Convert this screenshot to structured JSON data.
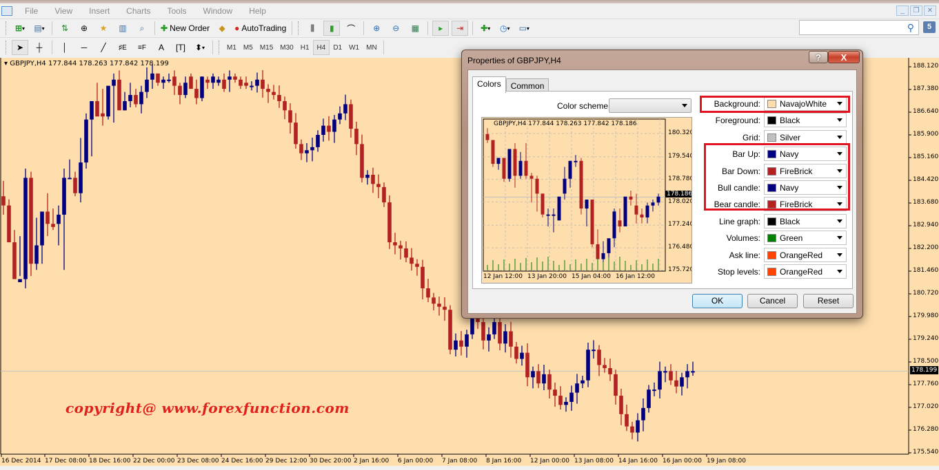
{
  "app": {
    "menu": [
      "File",
      "View",
      "Insert",
      "Charts",
      "Tools",
      "Window",
      "Help"
    ],
    "window_controls": [
      "minimize",
      "restore",
      "close"
    ]
  },
  "toolbar": {
    "new_order_label": "New Order",
    "autotrading_label": "AutoTrading",
    "timeframes": [
      "M1",
      "M5",
      "M15",
      "M30",
      "H1",
      "H4",
      "D1",
      "W1",
      "MN"
    ],
    "active_timeframe": "H4",
    "search_placeholder": "",
    "notification_count": "5"
  },
  "chart": {
    "symbol_header": "GBPJPY,H4  177.844 178.263 177.842 178.199",
    "current_price": "178.199",
    "watermark": "copyright@ www.forexfunction.com",
    "colors": {
      "background": "#ffdead",
      "bull": "#000080",
      "bear": "#b22222",
      "grid": "#c0c0c0"
    }
  },
  "chart_data": {
    "type": "candlestick",
    "title": "GBPJPY,H4",
    "ohlc_header": {
      "open": 177.844,
      "high": 178.263,
      "low": 177.842,
      "close": 178.199
    },
    "y_ticks": [
      "188.120",
      "187.380",
      "186.640",
      "185.900",
      "185.160",
      "184.420",
      "183.680",
      "182.940",
      "182.200",
      "181.460",
      "180.720",
      "179.980",
      "179.240",
      "178.500",
      "177.760",
      "177.020",
      "176.280",
      "175.540"
    ],
    "ylim": [
      175.54,
      188.12
    ],
    "x_ticks": [
      "16 Dec 2014",
      "17 Dec 08:00",
      "18 Dec 16:00",
      "22 Dec 00:00",
      "23 Dec 08:00",
      "24 Dec 16:00",
      "29 Dec 12:00",
      "30 Dec 20:00",
      "2 Jan 16:00",
      "6 Jan 00:00",
      "7 Jan 08:00",
      "8 Jan 16:00",
      "12 Jan 00:00",
      "13 Jan 08:00",
      "14 Jan 16:00",
      "16 Jan 00:00",
      "19 Jan 08:00"
    ],
    "current_price_line": 178.199,
    "candles": [
      [
        183.9,
        184.4,
        183.3,
        183.6
      ],
      [
        183.6,
        183.8,
        182.6,
        182.4
      ],
      [
        182.4,
        182.8,
        181.5,
        181.2
      ],
      [
        181.1,
        182.6,
        181.3,
        181.2
      ],
      [
        181.2,
        184.8,
        180.9,
        184.5
      ],
      [
        184.5,
        184.7,
        181.3,
        181.7
      ],
      [
        181.7,
        183.2,
        181.5,
        182.3
      ],
      [
        182.3,
        183.4,
        181.7,
        183.4
      ],
      [
        183.4,
        184.0,
        182.6,
        183.0
      ],
      [
        183.0,
        183.5,
        182.8,
        182.9
      ],
      [
        183.0,
        183.6,
        182.3,
        183.3
      ],
      [
        183.3,
        184.8,
        181.5,
        184.5
      ],
      [
        184.5,
        185.1,
        184.5,
        184.5
      ],
      [
        184.5,
        184.7,
        183.9,
        184.0
      ],
      [
        184.0,
        185.8,
        183.7,
        185.0
      ],
      [
        185.0,
        186.6,
        184.8,
        186.4
      ],
      [
        186.4,
        187.0,
        185.2,
        187.0
      ],
      [
        187.0,
        187.6,
        186.8,
        186.5
      ],
      [
        186.6,
        187.4,
        186.2,
        186.5
      ],
      [
        186.5,
        187.4,
        186.4,
        187.5
      ],
      [
        187.5,
        187.9,
        186.3,
        187.7
      ],
      [
        187.7,
        188.0,
        186.8,
        186.7
      ],
      [
        186.7,
        187.3,
        186.7,
        187.0
      ],
      [
        187.0,
        187.6,
        186.8,
        187.2
      ],
      [
        187.2,
        187.4,
        186.8,
        186.9
      ],
      [
        186.9,
        187.5,
        186.6,
        187.3
      ],
      [
        187.3,
        188.1,
        187.1,
        187.7
      ],
      [
        187.7,
        188.2,
        187.4,
        187.9
      ],
      [
        187.9,
        187.9,
        187.5,
        187.6
      ],
      [
        187.6,
        187.8,
        187.4,
        187.7
      ],
      [
        187.7,
        187.9,
        187.6,
        187.7
      ],
      [
        187.8,
        188.0,
        187.2,
        187.5
      ],
      [
        187.5,
        187.6,
        186.9,
        187.2
      ],
      [
        187.2,
        187.8,
        187.1,
        187.6
      ],
      [
        187.8,
        187.9,
        187.4,
        187.4
      ],
      [
        187.4,
        187.7,
        186.9,
        187.1
      ],
      [
        187.1,
        187.8,
        187.0,
        187.8
      ],
      [
        187.7,
        187.8,
        187.4,
        187.6
      ],
      [
        187.6,
        187.9,
        187.4,
        187.8
      ],
      [
        187.6,
        187.8,
        187.5,
        187.7
      ],
      [
        187.7,
        187.9,
        187.3,
        187.4
      ],
      [
        187.7,
        188.0,
        187.3,
        187.8
      ],
      [
        187.8,
        187.9,
        187.6,
        187.7
      ],
      [
        187.7,
        187.8,
        187.4,
        187.5
      ],
      [
        187.6,
        187.8,
        187.4,
        187.5
      ]
    ]
  },
  "dialog": {
    "title": "Properties of GBPJPY,H4",
    "tabs": [
      {
        "label": "Colors",
        "active": true
      },
      {
        "label": "Common",
        "active": false
      }
    ],
    "color_scheme_label": "Color scheme:",
    "color_scheme_value": "",
    "preview": {
      "header": "GBPJPY,H4  177.844 178.263 177.842 178.186",
      "current_price": "178.186",
      "y_ticks": [
        "180.320",
        "179.540",
        "178.780",
        "178.020",
        "177.240",
        "176.480",
        "175.720"
      ],
      "x_ticks": [
        "12 Jan 12:00",
        "13 Jan 20:00",
        "15 Jan 04:00",
        "16 Jan 12:00"
      ]
    },
    "color_settings": [
      {
        "label": "Background:",
        "value": "NavajoWhite",
        "color": "#ffdead"
      },
      {
        "label": "Foreground:",
        "value": "Black",
        "color": "#000000"
      },
      {
        "label": "Grid:",
        "value": "Silver",
        "color": "#c0c0c0"
      },
      {
        "label": "Bar Up:",
        "value": "Navy",
        "color": "#000080"
      },
      {
        "label": "Bar Down:",
        "value": "FireBrick",
        "color": "#b22222"
      },
      {
        "label": "Bull candle:",
        "value": "Navy",
        "color": "#000080"
      },
      {
        "label": "Bear candle:",
        "value": "FireBrick",
        "color": "#b22222"
      },
      {
        "label": "Line graph:",
        "value": "Black",
        "color": "#000000"
      },
      {
        "label": "Volumes:",
        "value": "Green",
        "color": "#008000"
      },
      {
        "label": "Ask line:",
        "value": "OrangeRed",
        "color": "#ff4500"
      },
      {
        "label": "Stop levels:",
        "value": "OrangeRed",
        "color": "#ff4500"
      }
    ],
    "buttons": {
      "ok": "OK",
      "cancel": "Cancel",
      "reset": "Reset"
    },
    "help_label": "?",
    "close_label": "X"
  }
}
